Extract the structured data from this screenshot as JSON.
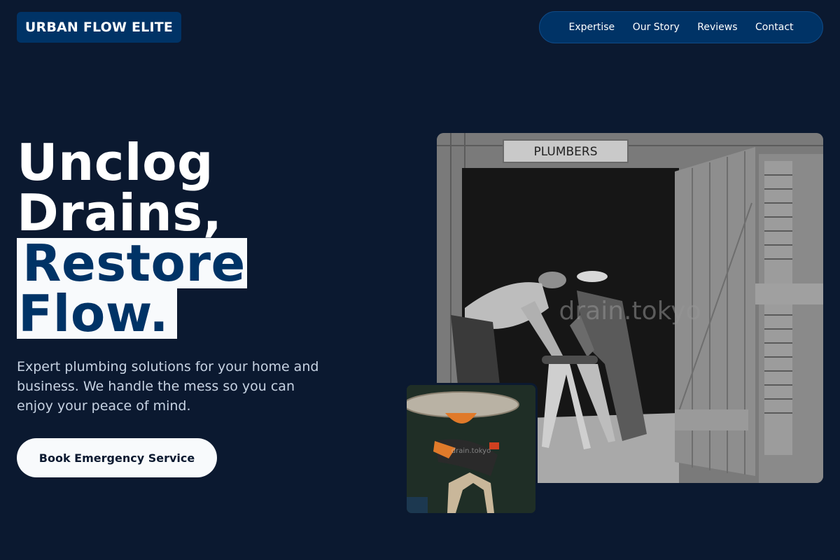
{
  "header": {
    "logo": "URBAN FLOW ELITE",
    "nav": [
      "Expertise",
      "Our Story",
      "Reviews",
      "Contact"
    ]
  },
  "hero": {
    "title_line1": "Unclog",
    "title_line2": "Drains,",
    "title_line3": "Restore",
    "title_line4": "Flow.",
    "description": "Expert plumbing solutions for your home and business. We handle the mess so you can enjoy your peace of mind.",
    "cta": "Book Emergency Service"
  },
  "images": {
    "main_sign": "PLUMBERS",
    "main_watermark": "drain.tokyo",
    "inset_watermark": "drain.tokyo"
  },
  "colors": {
    "background": "#0b1930",
    "brand_navy": "#003366",
    "light": "#f8fafc"
  }
}
